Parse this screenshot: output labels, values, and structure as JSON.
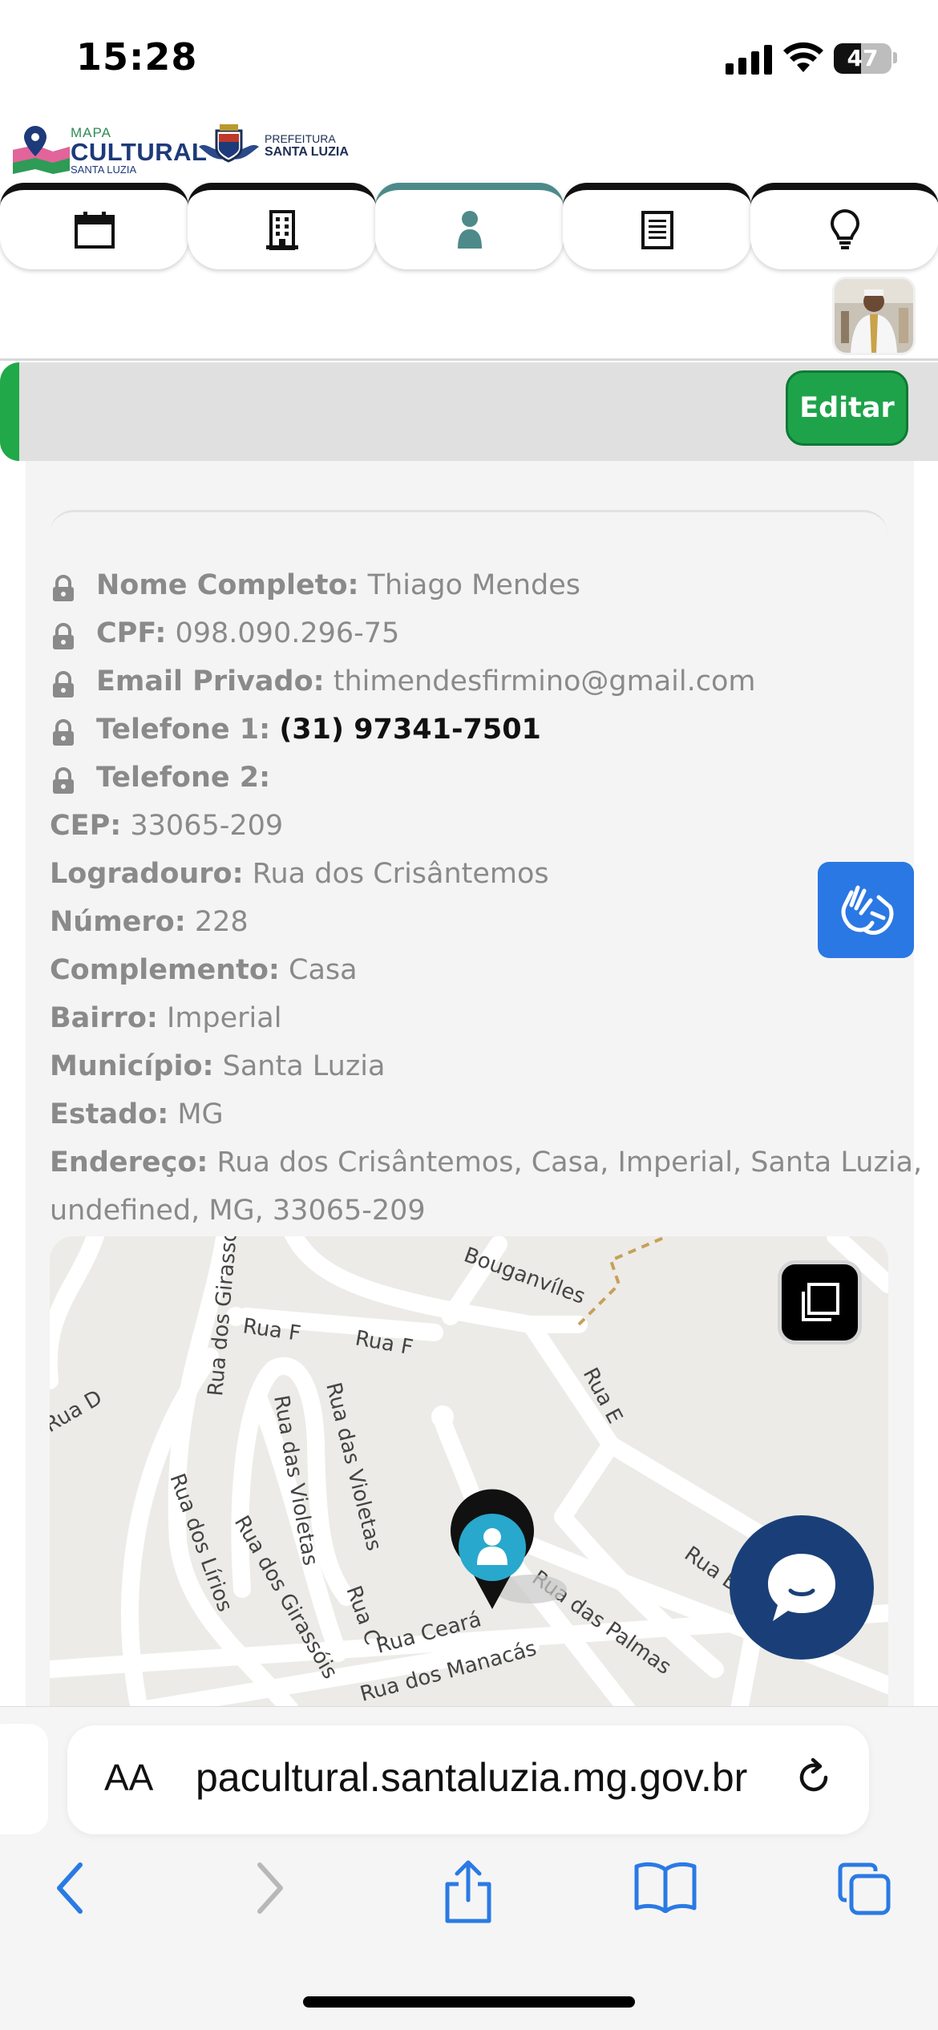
{
  "status_bar": {
    "time": "15:28",
    "battery": "47",
    "battery_level": 0.47
  },
  "header": {
    "logo": {
      "small": "MAPA",
      "big": "CULTURAL",
      "sub": "SANTA LUZIA"
    },
    "prefeitura": {
      "line1": "PREFEITURA",
      "line2": "SANTA LUZIA"
    }
  },
  "tabs": [
    {
      "icon": "calendar-icon"
    },
    {
      "icon": "building-icon"
    },
    {
      "icon": "person-icon",
      "active": true
    },
    {
      "icon": "document-icon"
    },
    {
      "icon": "lightbulb-icon"
    }
  ],
  "profile": {
    "edit_label": "Editar",
    "fields": [
      {
        "label": "Nome Completo:",
        "value": "Thiago Mendes",
        "private": true
      },
      {
        "label": "CPF:",
        "value": "098.090.296-75",
        "private": true
      },
      {
        "label": "Email Privado:",
        "value": "thimendesfirmino@gmail.com",
        "private": true
      },
      {
        "label": "Telefone 1:",
        "value": "(31) 97341-7501",
        "private": true
      },
      {
        "label": "Telefone 2:",
        "value": "",
        "private": true
      },
      {
        "label": "CEP:",
        "value": "33065-209",
        "private": false
      },
      {
        "label": "Logradouro:",
        "value": "Rua dos Crisântemos",
        "private": false
      },
      {
        "label": "Número:",
        "value": "228",
        "private": false
      },
      {
        "label": "Complemento:",
        "value": "Casa",
        "private": false
      },
      {
        "label": "Bairro:",
        "value": "Imperial",
        "private": false
      },
      {
        "label": "Município:",
        "value": "Santa Luzia",
        "private": false
      },
      {
        "label": "Estado:",
        "value": "MG",
        "private": false
      }
    ],
    "address": {
      "label": "Endereço:",
      "value_line1": "Rua dos Crisântemos, Casa, Imperial, Santa Luzia,",
      "value_line2": "undefined, MG, 33065-209"
    }
  },
  "map": {
    "streets": [
      "Bouganvíles",
      "Rua F",
      "Rua F",
      "Rua dos Girassóis",
      "Rua das Violetas",
      "Rua das Violetas",
      "Rua E",
      "Rua D",
      "Rua dos Lírios",
      "Rua dos Girassóis",
      "Rua C",
      "Rua Ceará",
      "Rua das Palmas",
      "Rua B",
      "Rua dos Manacás"
    ]
  },
  "browser": {
    "text_size_label": "AA",
    "url": "pacultural.santaluzia.mg.gov.br"
  }
}
